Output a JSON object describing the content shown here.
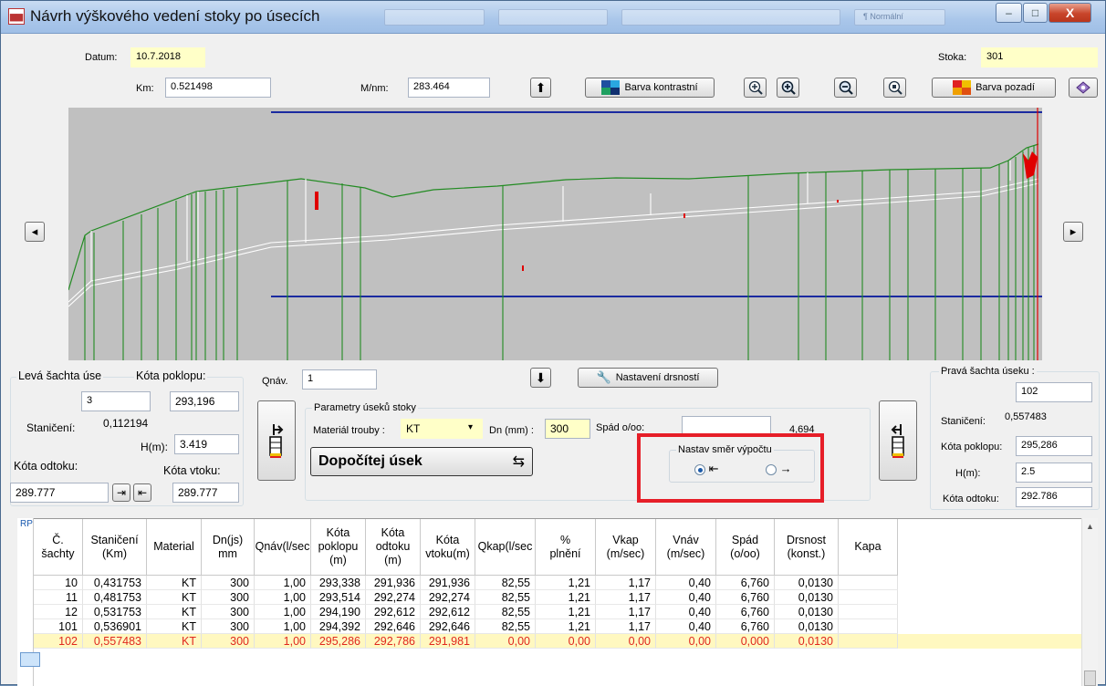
{
  "window": {
    "title": "Návrh výškového vedení stoky po úsecích",
    "app_icon": "chart-icon",
    "ghost_toolbar_text": "¶ Normální",
    "buttons": {
      "minimize": "–",
      "maximize": "□",
      "close": "X"
    }
  },
  "header": {
    "datum_label": "Datum:",
    "datum_value": "10.7.2018",
    "stoka_label": "Stoka:",
    "stoka_value": "301",
    "km_label": "Km:",
    "km_value": "0.521498",
    "mnm_label": "M/nm:",
    "mnm_value": "283.464",
    "barva_kontrastni": "Barva kontrastní",
    "barva_pozadi": "Barva pozadí",
    "zoom_icons": [
      "zoom-in-icon",
      "zoom-in-plus-icon",
      "zoom-out-icon",
      "zoom-fit-icon"
    ]
  },
  "chart": {
    "background": "#c0c0c0",
    "terrain_color": "#228b22",
    "pipe_color": "#ffffff",
    "marker_color": "#e00000",
    "level_line_color": "#1a2aa0"
  },
  "left_panel": {
    "title": "Levá šachta úse",
    "kota_poklopu_label": "Kóta poklopu:",
    "sachta_value": "3",
    "kota_poklopu_value": "293,196",
    "staniceni_label": "Staničení:",
    "staniceni_value": "0,112194",
    "h_label": "H(m):",
    "h_value": "3.419",
    "kota_odtoku_label": "Kóta odtoku:",
    "kota_vtoku_label": "Kóta vtoku:",
    "kota_odtoku_value": "289.777",
    "kota_vtoku_value": "289.777"
  },
  "middle_panel": {
    "qnav_label": "Qnáv.",
    "qnav_value": "1",
    "nastaveni_drsnosti": "Nastavení drsností",
    "parametry_label": "Parametry úseků stoky",
    "material_label": "Materiál trouby :",
    "material_value": "KT",
    "dn_label": "Dn (mm) :",
    "dn_value": "300",
    "spad_label": "Spád o/oo:",
    "spad_value": "4,694",
    "dopocitej": "Dopočítej úsek",
    "nastav_smer": "Nastav směr výpočtu"
  },
  "right_panel": {
    "title": "Pravá šachta úseku :",
    "sachta_value": "102",
    "staniceni_label": "Staničení:",
    "staniceni_value": "0,557483",
    "kota_poklopu_label": "Kóta poklopu:",
    "kota_poklopu_value": "295,286",
    "h_label": "H(m):",
    "h_value": "2.5",
    "kota_odtoku_label": "Kóta odtoku:",
    "kota_odtoku_value": "292.786"
  },
  "table": {
    "rp_label": "RP",
    "headers": [
      "Č.\nšachty",
      "Staničení\n(Km)",
      "Material",
      "Dn(js)\nmm",
      "Qnáv(l/sec",
      "Kóta\npoklopu\n(m)",
      "Kóta\nodtoku\n(m)",
      "Kóta\nvtoku(m)",
      "Qkap(l/sec",
      "%\nplnění",
      "Vkap\n(m/sec)",
      "Vnáv\n(m/sec)",
      "Spád\n(o/oo)",
      "Drsnost\n(konst.)",
      "Kapa"
    ],
    "rows": [
      [
        "10",
        "0,431753",
        "KT",
        "300",
        "1,00",
        "293,338",
        "291,936",
        "291,936",
        "82,55",
        "1,21",
        "1,17",
        "0,40",
        "6,760",
        "0,0130",
        ""
      ],
      [
        "11",
        "0,481753",
        "KT",
        "300",
        "1,00",
        "293,514",
        "292,274",
        "292,274",
        "82,55",
        "1,21",
        "1,17",
        "0,40",
        "6,760",
        "0,0130",
        ""
      ],
      [
        "12",
        "0,531753",
        "KT",
        "300",
        "1,00",
        "294,190",
        "292,612",
        "292,612",
        "82,55",
        "1,21",
        "1,17",
        "0,40",
        "6,760",
        "0,0130",
        ""
      ],
      [
        "101",
        "0,536901",
        "KT",
        "300",
        "1,00",
        "294,392",
        "292,646",
        "292,646",
        "82,55",
        "1,21",
        "1,17",
        "0,40",
        "6,760",
        "0,0130",
        ""
      ],
      [
        "102",
        "0,557483",
        "KT",
        "300",
        "1,00",
        "295,286",
        "292,786",
        "291,981",
        "0,00",
        "0,00",
        "0,00",
        "0,00",
        "0,000",
        "0,0130",
        ""
      ]
    ],
    "highlight_row_index": 4
  }
}
